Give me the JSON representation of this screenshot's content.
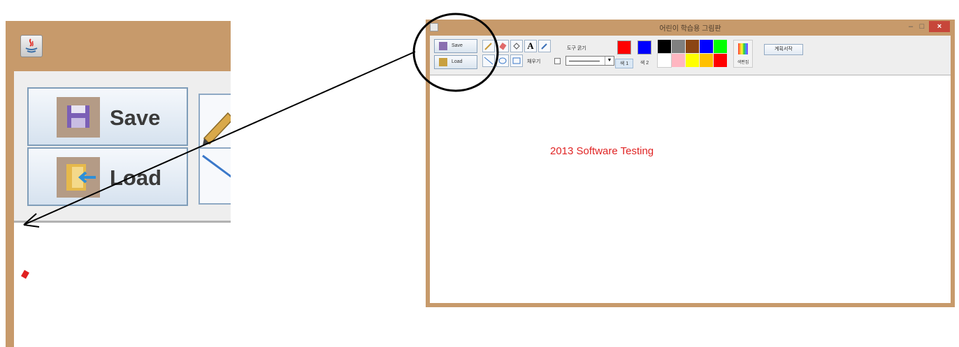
{
  "zoom": {
    "save_label": "Save",
    "load_label": "Load"
  },
  "app": {
    "title": "어린이 학습용 그림판",
    "window_controls": {
      "minimize": "–",
      "maximize": "□",
      "close": "×"
    },
    "toolbar": {
      "save_label": "Save",
      "load_label": "Load",
      "text_tool": "A",
      "fill_label": "채우기",
      "thickness_label": "도구 굵기",
      "color1_label": "색 1",
      "color2_label": "색 2",
      "edit_color_label": "색편집",
      "plan_label": "계획서작"
    },
    "selected_colors": {
      "color1": "#ff0000",
      "color2": "#0000ff"
    },
    "palette": [
      "#000000",
      "#808080",
      "#8b4513",
      "#0000ff",
      "#00ff00",
      "#ffffff",
      "#ffb6c1",
      "#ffff00",
      "#ffc000",
      "#ff0000"
    ],
    "canvas_text": "2013 Software Testing",
    "canvas_text_color": "#e02424"
  },
  "colors": {
    "window_frame": "#c79a6b",
    "toolbar_bg": "#eeeeee",
    "annotation": "#000000"
  }
}
